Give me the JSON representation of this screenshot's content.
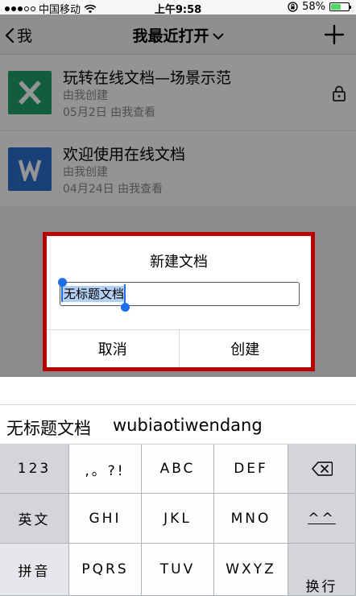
{
  "status_bar": {
    "carrier": "中国移动",
    "time": "上午9:58",
    "battery_percent": "58%",
    "battery_level": 0.58
  },
  "nav": {
    "back_label": "我",
    "title": "我最近打开"
  },
  "documents": [
    {
      "title": "玩转在线文档—场景示范",
      "owner": "由我创建",
      "date": "05月2日 由我查看",
      "type": "excel",
      "icon_letter": "X",
      "locked": true
    },
    {
      "title": "欢迎使用在线文档",
      "owner": "由我创建",
      "date": "04月24日 由我查看",
      "type": "word",
      "icon_letter": "W",
      "locked": false
    }
  ],
  "dialog": {
    "title": "新建文档",
    "input_value": "无标题文档",
    "cancel_label": "取消",
    "create_label": "创建"
  },
  "candidate": {
    "word": "无标题文档",
    "pinyin": "wubiaotiwendang"
  },
  "keyboard": {
    "row1": [
      "123",
      ",。?!",
      "ABC",
      "DEF"
    ],
    "row2": [
      "英文",
      "GHI",
      "JKL",
      "MNO",
      "^^"
    ],
    "row3": [
      "拼音",
      "PQRS",
      "TUV",
      "WXYZ"
    ],
    "return_label": "换行"
  },
  "colors": {
    "excel_green": "#1f9f6d",
    "word_blue": "#2b6fd0",
    "highlight_red": "#b80000",
    "selection_blue": "#1d6ee8",
    "battery_green": "#4cd964"
  }
}
